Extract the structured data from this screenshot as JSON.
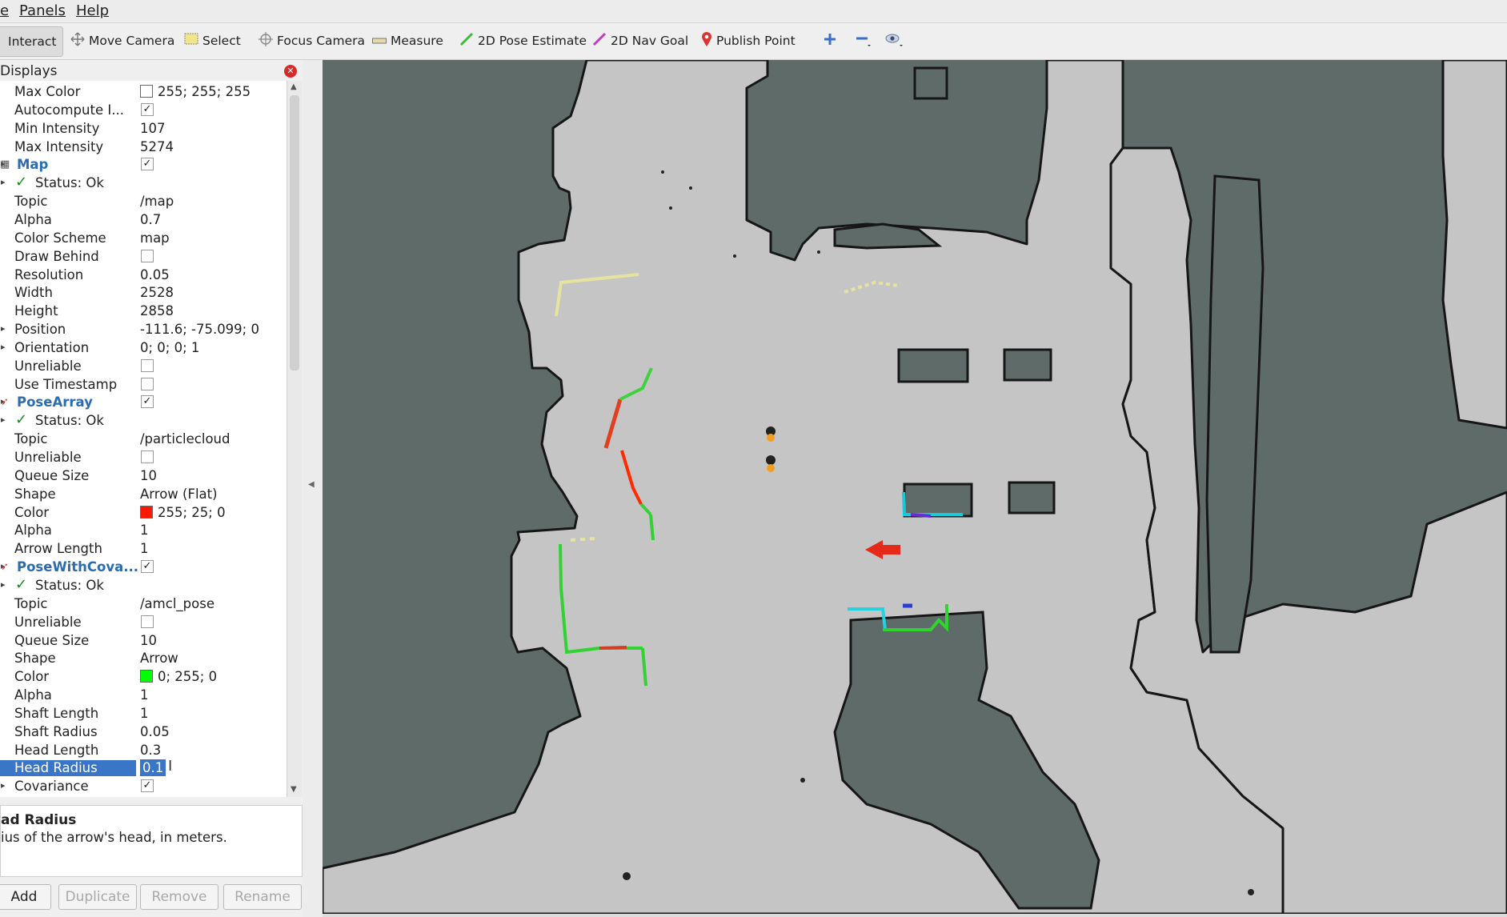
{
  "menubar": {
    "items": [
      "e",
      "Panels",
      "Help"
    ]
  },
  "toolbar": {
    "tools": [
      {
        "label": "Interact",
        "icon": "interact-icon"
      },
      {
        "label": "Move Camera",
        "icon": "move-camera-icon"
      },
      {
        "label": "Select",
        "icon": "select-icon"
      },
      {
        "label": "Focus Camera",
        "icon": "focus-camera-icon"
      },
      {
        "label": "Measure",
        "icon": "measure-icon"
      },
      {
        "label": "2D Pose Estimate",
        "icon": "pose-estimate-icon"
      },
      {
        "label": "2D Nav Goal",
        "icon": "nav-goal-icon"
      },
      {
        "label": "Publish Point",
        "icon": "publish-point-icon"
      }
    ],
    "extra_icons": [
      "add-tool-icon",
      "remove-tool-icon",
      "eye-dropdown-icon"
    ]
  },
  "displays_panel": {
    "title": "Displays",
    "rows": [
      {
        "name": "Max Color",
        "value": "255; 255; 255",
        "swatch": "#ffffff"
      },
      {
        "name": "Autocompute I...",
        "checkbox": true
      },
      {
        "name": "Min Intensity",
        "value": "107"
      },
      {
        "name": "Max Intensity",
        "value": "5274"
      },
      {
        "name": "Map",
        "display": true,
        "checkbox": true,
        "icon": "map-icon"
      },
      {
        "name": "Status: Ok",
        "status": true
      },
      {
        "name": "Topic",
        "value": "/map"
      },
      {
        "name": "Alpha",
        "value": "0.7"
      },
      {
        "name": "Color Scheme",
        "value": "map"
      },
      {
        "name": "Draw Behind",
        "checkbox": false
      },
      {
        "name": "Resolution",
        "value": "0.05"
      },
      {
        "name": "Width",
        "value": "2528"
      },
      {
        "name": "Height",
        "value": "2858"
      },
      {
        "name": "Position",
        "value": "-111.6; -75.099; 0",
        "expandable": true
      },
      {
        "name": "Orientation",
        "value": "0; 0; 0; 1",
        "expandable": true
      },
      {
        "name": "Unreliable",
        "checkbox": false
      },
      {
        "name": "Use Timestamp",
        "checkbox": false
      },
      {
        "name": "PoseArray",
        "display": true,
        "checkbox": true,
        "icon": "pose-array-icon"
      },
      {
        "name": "Status: Ok",
        "status": true
      },
      {
        "name": "Topic",
        "value": "/particlecloud"
      },
      {
        "name": "Unreliable",
        "checkbox": false
      },
      {
        "name": "Queue Size",
        "value": "10"
      },
      {
        "name": "Shape",
        "value": "Arrow (Flat)"
      },
      {
        "name": "Color",
        "value": "255; 25; 0",
        "swatch": "#ff1900"
      },
      {
        "name": "Alpha",
        "value": "1"
      },
      {
        "name": "Arrow Length",
        "value": "1"
      },
      {
        "name": "PoseWithCova...",
        "display": true,
        "checkbox": true,
        "icon": "pose-covariance-icon"
      },
      {
        "name": "Status: Ok",
        "status": true
      },
      {
        "name": "Topic",
        "value": "/amcl_pose"
      },
      {
        "name": "Unreliable",
        "checkbox": false
      },
      {
        "name": "Queue Size",
        "value": "10"
      },
      {
        "name": "Shape",
        "value": "Arrow"
      },
      {
        "name": "Color",
        "value": "0; 255; 0",
        "swatch": "#00ff00"
      },
      {
        "name": "Alpha",
        "value": "1"
      },
      {
        "name": "Shaft Length",
        "value": "1"
      },
      {
        "name": "Shaft Radius",
        "value": "0.05"
      },
      {
        "name": "Head Length",
        "value": "0.3"
      },
      {
        "name": "Head Radius",
        "value": "0.1",
        "selected": true
      },
      {
        "name": "Covariance",
        "checkbox": true,
        "expandable": true
      }
    ],
    "description": {
      "title": "ad Radius",
      "text": "ius of the arrow's head, in meters."
    },
    "buttons": {
      "add": "Add",
      "duplicate": "Duplicate",
      "remove": "Remove",
      "rename": "Rename"
    }
  },
  "colors": {
    "map_free": "#c5c5c5",
    "map_unknown": "#5e6b69",
    "selection": "#3a76c8",
    "display_name": "#2b6cb0"
  }
}
